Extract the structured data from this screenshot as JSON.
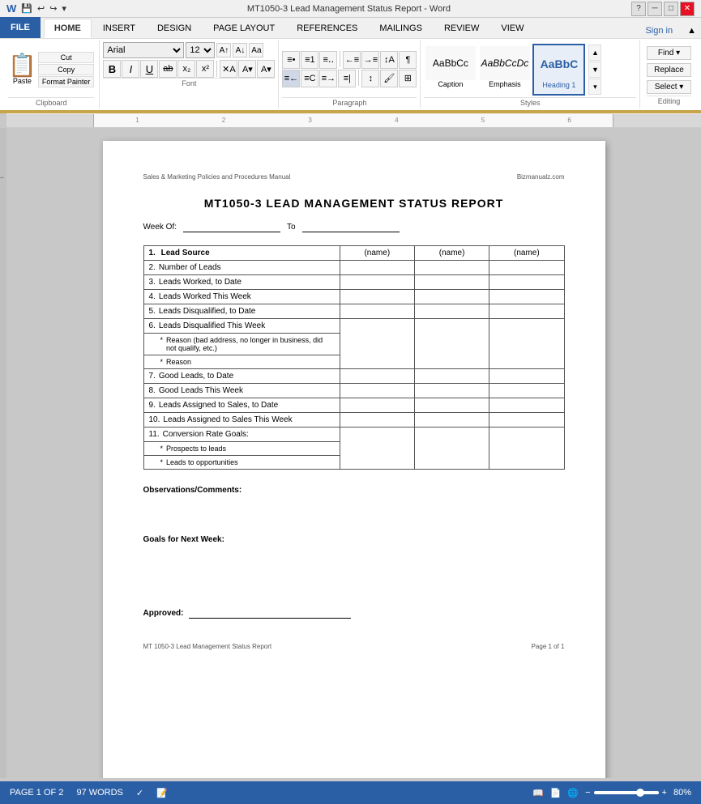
{
  "titlebar": {
    "title": "MT1050-3 Lead Management Status Report - Word",
    "help_icon": "?",
    "min_icon": "─",
    "max_icon": "□",
    "close_icon": "✕"
  },
  "ribbon": {
    "tabs": [
      "FILE",
      "HOME",
      "INSERT",
      "DESIGN",
      "PAGE LAYOUT",
      "REFERENCES",
      "MAILINGS",
      "REVIEW",
      "VIEW"
    ],
    "active_tab": "HOME",
    "sign_in": "Sign in",
    "clipboard": {
      "label": "Clipboard",
      "paste": "Paste",
      "cut": "Cut",
      "copy": "Copy",
      "format_painter": "Format Painter"
    },
    "font": {
      "label": "Font",
      "name": "Arial",
      "size": "12",
      "bold": "B",
      "italic": "I",
      "underline": "U",
      "strikethrough": "ab",
      "subscript": "x₂",
      "superscript": "x²",
      "text_color": "A",
      "highlight": "A"
    },
    "paragraph": {
      "label": "Paragraph"
    },
    "styles": {
      "label": "Styles",
      "items": [
        {
          "name": "Caption",
          "preview": "AaBbCc"
        },
        {
          "name": "Emphasis",
          "preview": "AaBbCcDc",
          "italic": true
        },
        {
          "name": "Heading 1",
          "preview": "AaBbC",
          "heading": true
        }
      ]
    },
    "editing": {
      "label": "Editing"
    }
  },
  "document": {
    "header_left": "Sales & Marketing Policies and Procedures Manual",
    "header_right": "Bizmanualz.com",
    "title": "MT1050-3 LEAD MANAGEMENT STATUS REPORT",
    "week_of_label": "Week Of:",
    "to_label": "To",
    "table": {
      "col_headers": [
        "(name)",
        "(name)",
        "(name)"
      ],
      "rows": [
        {
          "num": "1.",
          "label": "Lead Source",
          "is_header_row": true
        },
        {
          "num": "2.",
          "label": "Number of Leads"
        },
        {
          "num": "3.",
          "label": "Leads Worked, to Date"
        },
        {
          "num": "4.",
          "label": "Leads Worked This Week"
        },
        {
          "num": "5.",
          "label": "Leads Disqualified, to Date"
        },
        {
          "num": "6.",
          "label": "Leads Disqualified This Week",
          "sub": [
            "Reason (bad address, no longer in business, did not qualify, etc.)",
            "Reason"
          ]
        },
        {
          "num": "7.",
          "label": "Good Leads, to Date"
        },
        {
          "num": "8.",
          "label": "Good Leads This Week"
        },
        {
          "num": "9.",
          "label": "Leads Assigned to Sales, to Date"
        },
        {
          "num": "10.",
          "label": "Leads Assigned to Sales This Week"
        },
        {
          "num": "11.",
          "label": "Conversion Rate Goals:",
          "sub": [
            "Prospects to leads",
            "Leads to opportunities"
          ]
        }
      ]
    },
    "observations_label": "Observations/Comments:",
    "goals_label": "Goals for Next Week:",
    "approved_label": "Approved:",
    "footer_left": "MT 1050-3 Lead Management Status Report",
    "footer_right": "Page 1 of 1"
  },
  "statusbar": {
    "page_info": "PAGE 1 OF 2",
    "word_count": "97 WORDS",
    "zoom_level": "80%"
  }
}
